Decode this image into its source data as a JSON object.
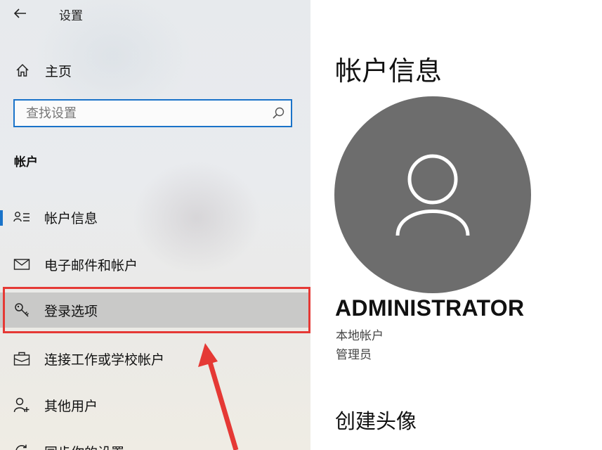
{
  "window": {
    "title": "设置"
  },
  "sidebar": {
    "home_label": "主页",
    "search": {
      "placeholder": "查找设置",
      "value": ""
    },
    "section_title": "帐户",
    "items": [
      {
        "label": "帐户信息",
        "icon": "account-info-icon"
      },
      {
        "label": "电子邮件和帐户",
        "icon": "mail-icon"
      },
      {
        "label": "登录选项",
        "icon": "key-icon"
      },
      {
        "label": "连接工作或学校帐户",
        "icon": "briefcase-icon"
      },
      {
        "label": "其他用户",
        "icon": "add-user-icon"
      },
      {
        "label": "同步你的设置",
        "icon": "sync-icon"
      }
    ]
  },
  "main": {
    "page_title": "帐户信息",
    "user": {
      "name": "ADMINISTRATOR",
      "account_type": "本地帐户",
      "role": "管理员"
    },
    "create_avatar_title": "创建头像"
  },
  "colors": {
    "accent": "#1a73c9",
    "annotation": "#e53935",
    "avatar_bg": "#6d6d6d"
  }
}
